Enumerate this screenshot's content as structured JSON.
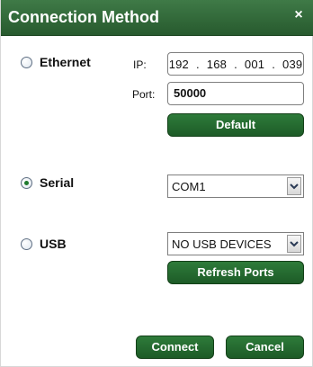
{
  "dialog": {
    "title": "Connection Method",
    "close_icon": "close-icon"
  },
  "ethernet": {
    "label": "Ethernet",
    "selected": false,
    "ip_label": "IP:",
    "ip_octets": [
      "192",
      "168",
      "001",
      "039"
    ],
    "ip_separator": ".",
    "port_label": "Port:",
    "port_value": "50000",
    "default_button": "Default"
  },
  "serial": {
    "label": "Serial",
    "selected": true,
    "port_value": "COM1"
  },
  "usb": {
    "label": "USB",
    "selected": false,
    "device_value": "NO USB DEVICES",
    "refresh_button": "Refresh Ports"
  },
  "actions": {
    "connect": "Connect",
    "cancel": "Cancel"
  },
  "colors": {
    "accent": "#2e7b3a",
    "titlebar": "#3f7a47"
  }
}
